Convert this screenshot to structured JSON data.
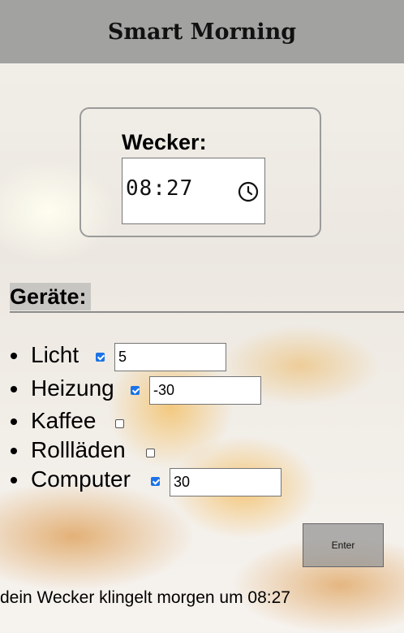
{
  "header": {
    "title": "Smart Morning"
  },
  "alarm": {
    "label": "Wecker:",
    "time": "08:27"
  },
  "devices": {
    "title": "Geräte:",
    "items": [
      {
        "name": "Licht",
        "checked": true,
        "value": "5"
      },
      {
        "name": "Heizung",
        "checked": true,
        "value": "-30"
      },
      {
        "name": "Kaffee",
        "checked": false
      },
      {
        "name": "Rollläden",
        "checked": false
      },
      {
        "name": "Computer",
        "checked": true,
        "value": "30"
      }
    ]
  },
  "enter_button": {
    "label": "Enter"
  },
  "status": {
    "text": "dein Wecker klingelt morgen um 08:27"
  },
  "colors": {
    "header_bg": "#a2a2a0",
    "checkbox_checked": "#1a73e8"
  },
  "icons": {
    "time_picker": "clock-icon"
  }
}
